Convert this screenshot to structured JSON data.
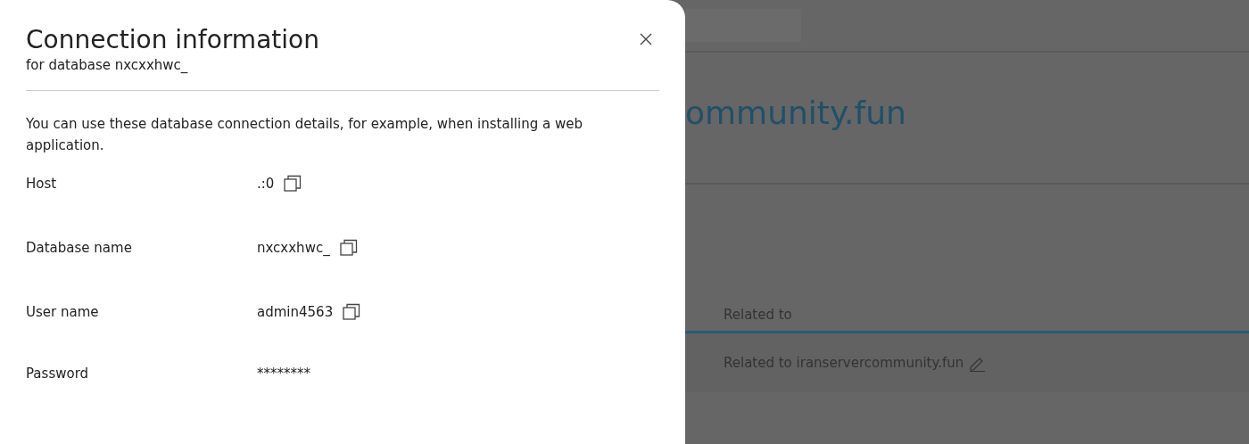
{
  "dialog": {
    "title": "Connection information",
    "subtitle": "for database nxcxxhwc_",
    "description": "You can use these database connection details, for example, when installing a web application.",
    "fields": [
      {
        "label": "Host",
        "value": ".:0",
        "copyable": true
      },
      {
        "label": "Database name",
        "value": "nxcxxhwc_",
        "copyable": true
      },
      {
        "label": "User name",
        "value": "admin4563",
        "copyable": true
      },
      {
        "label": "Password",
        "value": "********",
        "copyable": false
      }
    ]
  },
  "background": {
    "heading": "ommunity.fun",
    "table": {
      "column_header": "Related to",
      "rows": [
        {
          "related_to": "Related to iranservercommunity.fun"
        }
      ]
    }
  }
}
